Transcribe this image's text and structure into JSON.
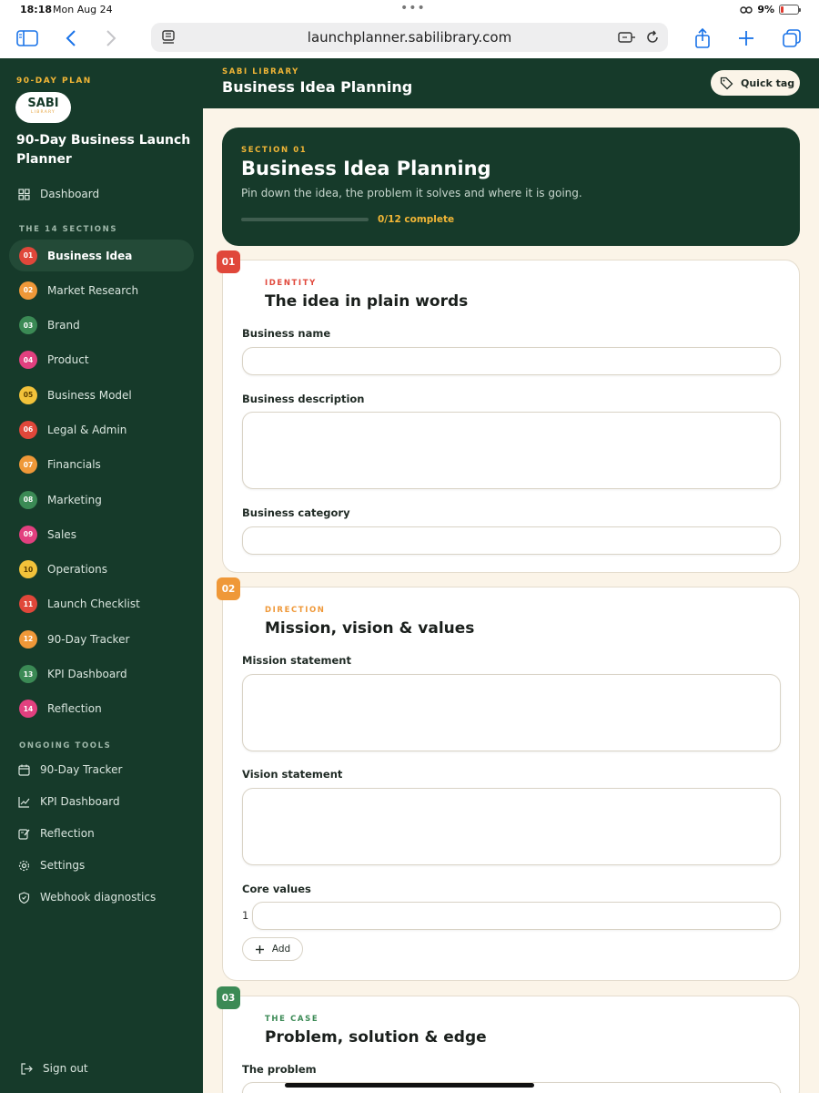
{
  "status": {
    "time": "18:18",
    "date": "Mon Aug 24",
    "battery": "9%"
  },
  "browser": {
    "url": "launchplanner.sabilibrary.com"
  },
  "sidebar": {
    "eyebrow": "90-DAY PLAN",
    "logo_main": "SABI",
    "logo_sub": "LIBRARY",
    "title": "90-Day Business Launch Planner",
    "dashboard": "Dashboard",
    "sections_heading": "THE 14 SECTIONS",
    "sections": [
      {
        "num": "01",
        "label": "Business Idea",
        "color": "#e0473a"
      },
      {
        "num": "02",
        "label": "Market Research",
        "color": "#ef9838"
      },
      {
        "num": "03",
        "label": "Brand",
        "color": "#3b8a55"
      },
      {
        "num": "04",
        "label": "Product",
        "color": "#e2407f"
      },
      {
        "num": "05",
        "label": "Business Model",
        "color": "#f2c23a"
      },
      {
        "num": "06",
        "label": "Legal & Admin",
        "color": "#e0473a"
      },
      {
        "num": "07",
        "label": "Financials",
        "color": "#ef9838"
      },
      {
        "num": "08",
        "label": "Marketing",
        "color": "#3b8a55"
      },
      {
        "num": "09",
        "label": "Sales",
        "color": "#e2407f"
      },
      {
        "num": "10",
        "label": "Operations",
        "color": "#f2c23a"
      },
      {
        "num": "11",
        "label": "Launch Checklist",
        "color": "#e0473a"
      },
      {
        "num": "12",
        "label": "90-Day Tracker",
        "color": "#ef9838"
      },
      {
        "num": "13",
        "label": "KPI Dashboard",
        "color": "#3b8a55"
      },
      {
        "num": "14",
        "label": "Reflection",
        "color": "#e2407f"
      }
    ],
    "tools_heading": "ONGOING TOOLS",
    "tools": [
      "90-Day Tracker",
      "KPI Dashboard",
      "Reflection",
      "Settings",
      "Webhook diagnostics"
    ],
    "sign_out": "Sign out"
  },
  "header": {
    "eyebrow": "SABI LIBRARY",
    "title": "Business Idea Planning",
    "quick_tag": "Quick tag"
  },
  "hero": {
    "eyebrow": "SECTION 01",
    "title": "Business Idea Planning",
    "description": "Pin down the idea, the problem it solves and where it is going.",
    "progress_text": "0/12 complete",
    "progress": 0
  },
  "cards": [
    {
      "badge": "01",
      "eyebrow": "IDENTITY",
      "title": "The idea in plain words",
      "fields": [
        "Business name",
        "Business description",
        "Business category"
      ]
    },
    {
      "badge": "02",
      "eyebrow": "DIRECTION",
      "title": "Mission, vision & values",
      "fields": [
        "Mission statement",
        "Vision statement",
        "Core values"
      ],
      "value_index": "1",
      "add_label": "Add"
    },
    {
      "badge": "03",
      "eyebrow": "THE CASE",
      "title": "Problem, solution & edge",
      "fields": [
        "The problem"
      ]
    }
  ],
  "colors": {
    "sidebar_bg": "#163a2a",
    "accent": "#f2b636",
    "page_bg": "#fbf4e8",
    "badge_red": "#e0473a",
    "badge_orange": "#ef9838",
    "badge_green": "#3b8a55"
  }
}
